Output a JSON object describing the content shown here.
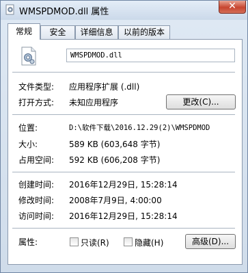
{
  "window": {
    "title": "WMSPDMOD.dll 属性",
    "close_label": "✕"
  },
  "tabs": [
    {
      "label": "常规",
      "active": true
    },
    {
      "label": "安全",
      "active": false
    },
    {
      "label": "详细信息",
      "active": false
    },
    {
      "label": "以前的版本",
      "active": false
    }
  ],
  "general": {
    "file_name": "WMSPDMOD.dll",
    "file_type_label": "文件类型:",
    "file_type_value": "应用程序扩展 (.dll)",
    "opens_with_label": "打开方式:",
    "opens_with_value": "未知应用程序",
    "change_button": "更改(C)...",
    "location_label": "位置:",
    "location_value": "D:\\软件下载\\2016.12.29(2)\\WMSPDMOD",
    "size_label": "大小:",
    "size_value": "589 KB (603,648 字节)",
    "size_on_disk_label": "占用空间:",
    "size_on_disk_value": "592 KB (606,208 字节)",
    "created_label": "创建时间:",
    "created_value": "2016年12月29日, 15:28:14",
    "modified_label": "修改时间:",
    "modified_value": "2008年7月9日, 4:00:00",
    "accessed_label": "访问时间:",
    "accessed_value": "2016年12月29日, 15:28:14",
    "attributes_label": "属性:",
    "readonly_label": "只读(R)",
    "readonly_checked": false,
    "hidden_label": "隐藏(H)",
    "hidden_checked": false,
    "advanced_button": "高级(D)..."
  }
}
